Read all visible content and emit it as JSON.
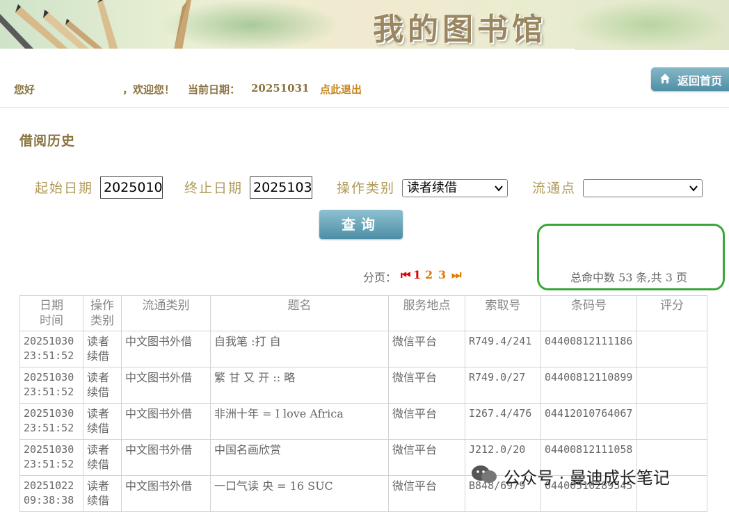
{
  "banner": {
    "title": "我的图书馆"
  },
  "welcome": {
    "greeting": "您好",
    "welcome_text": "，欢迎您！",
    "date_label": "当前日期：",
    "date_value": "20251031",
    "logout": "点此退出"
  },
  "home_button": {
    "label": "返回首页"
  },
  "section_title": "借阅历史",
  "filters": {
    "start_label": "起始日期",
    "start_value": "2025010",
    "end_label": "终止日期",
    "end_value": "2025103",
    "op_label": "操作类别",
    "op_value": "读者续借",
    "point_label": "流通点",
    "point_value": "",
    "query_button": "查询"
  },
  "pager": {
    "label": "分页：",
    "first": "⏮",
    "pages": [
      "1",
      "2",
      "3"
    ],
    "last": "⏭",
    "summary": "总命中数 53 条,共 3 页"
  },
  "table": {
    "headers": [
      "日期\n时间",
      "操作\n类别",
      "流通类别",
      "题名",
      "服务地点",
      "索取号",
      "条码号",
      "评分"
    ],
    "rows": [
      [
        "20251030 23:51:52",
        "读者 续借",
        "中文图书外借",
        "自我笔                        :打 自",
        "微信平台",
        "R749.4/241",
        "04400812111186",
        ""
      ],
      [
        "20251030 23:51:52",
        "读者 续借",
        "中文图书外借",
        "繁 甘 又 开                    :: 略",
        "微信平台",
        "R749.0/27",
        "04400812110899",
        ""
      ],
      [
        "20251030 23:51:52",
        "读者 续借",
        "中文图书外借",
        "非洲十年 = I love Africa",
        "微信平台",
        "I267.4/476",
        "04412010764067",
        ""
      ],
      [
        "20251030 23:51:52",
        "读者 续借",
        "中文图书外借",
        "中国名画欣赏",
        "微信平台",
        "J212.0/20",
        "04400812111058",
        ""
      ],
      [
        "20251022 09:38:38",
        "读者 续借",
        "中文图书外借",
        "一口气读         央 = 16 SUC",
        "微信平台",
        "B848/6979",
        "04400510289545",
        ""
      ]
    ]
  },
  "watermark": {
    "text": "公众号 · 曼迪成长笔记",
    "icon": "wechat-icon"
  },
  "colors": {
    "accent": "#8a7440",
    "button": "#4f8fa6",
    "pager_red": "#e00000",
    "pager_orange": "#e07b00",
    "highlight": "#3aa63a"
  }
}
